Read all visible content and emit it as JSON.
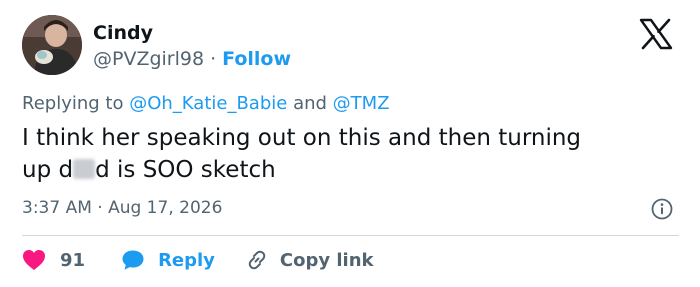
{
  "author": {
    "name": "Cindy",
    "handle": "@PVZgirl98",
    "separator": "·",
    "follow_label": "Follow"
  },
  "reply_context": {
    "prefix": "Replying to",
    "mention_1": "@Oh_Katie_Babie",
    "conjunction": "and",
    "mention_2": "@TMZ"
  },
  "tweet": {
    "line1": "I think her speaking out on this and then turning",
    "line2_start": "up d",
    "line2_end": "d is SOO sketch",
    "timestamp": "3:37 AM · Aug 17, 2026"
  },
  "actions": {
    "like_count": "91",
    "reply_label": "Reply",
    "copy_link_label": "Copy link"
  },
  "colors": {
    "accent": "#1d9bf0",
    "like": "#f91880",
    "text": "#0f1419",
    "secondary": "#536471",
    "divider": "#cfd9de"
  },
  "icons": {
    "brand": "x-logo-icon",
    "info": "info-icon",
    "like": "heart-icon",
    "reply": "speech-bubble-icon",
    "copy": "link-icon"
  }
}
